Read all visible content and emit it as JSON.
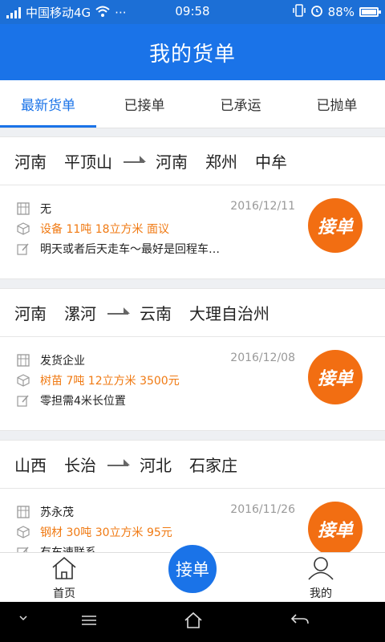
{
  "status_bar": {
    "carrier": "中国移动4G",
    "dots": "···",
    "time": "09:58",
    "battery": "88%"
  },
  "header": {
    "title": "我的货单"
  },
  "tabs": [
    {
      "label": "最新货单"
    },
    {
      "label": "已接单"
    },
    {
      "label": "已承运"
    },
    {
      "label": "已抛单"
    }
  ],
  "orders": [
    {
      "from": [
        "河南",
        "平顶山"
      ],
      "to": [
        "河南",
        "郑州",
        "中牟"
      ],
      "sender": "无",
      "cargo": "设备  11吨  18立方米  面议",
      "note": "明天或者后天走车～最好是回程车…",
      "date": "2016/12/11",
      "accept_label": "接单"
    },
    {
      "from": [
        "河南",
        "漯河"
      ],
      "to": [
        "云南",
        "大理自治州"
      ],
      "sender": "发货企业",
      "cargo": "树苗  7吨  12立方米  3500元",
      "note": "零担需4米长位置",
      "date": "2016/12/08",
      "accept_label": "接单"
    },
    {
      "from": [
        "山西",
        "长治"
      ],
      "to": [
        "河北",
        "石家庄"
      ],
      "sender": "苏永茂",
      "cargo": "钢材  30吨  30立方米  95元",
      "note": "有车速联系",
      "date": "2016/11/26",
      "accept_label": "接单"
    }
  ],
  "bottom_nav": {
    "home": "首页",
    "center": "接单",
    "mine": "我的"
  },
  "colors": {
    "primary": "#1a73e8",
    "accent": "#f26e12"
  }
}
